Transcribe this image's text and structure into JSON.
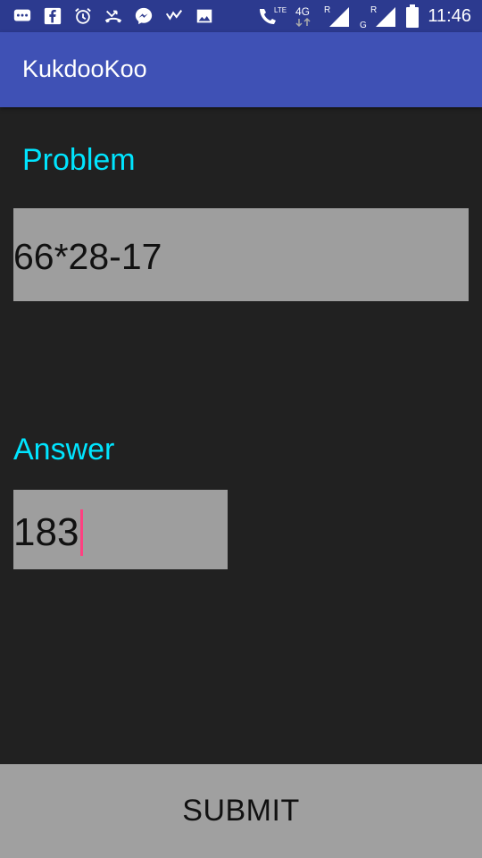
{
  "status_bar": {
    "time": "11:46",
    "network_label_1": "4G",
    "lte_label": "LTE",
    "roaming_1": "R",
    "roaming_2": "R",
    "sim2_label": "G",
    "left_icons": [
      "chat-bubble-icon",
      "facebook-icon",
      "alarm-icon",
      "missed-call-icon",
      "messenger-icon",
      "check-icon",
      "gallery-icon"
    ],
    "background": "#2c3a8f"
  },
  "app_bar": {
    "title": "KukdooKoo",
    "background": "#3f51b5"
  },
  "problem": {
    "label": "Problem",
    "value": "66*28-17"
  },
  "answer": {
    "label": "Answer",
    "value": "183"
  },
  "submit": {
    "label": "SUBMIT"
  },
  "colors": {
    "accent_label": "#00e5ff",
    "field_background": "#9e9e9e",
    "cursor": "#ff4081",
    "page_background": "#212121"
  }
}
